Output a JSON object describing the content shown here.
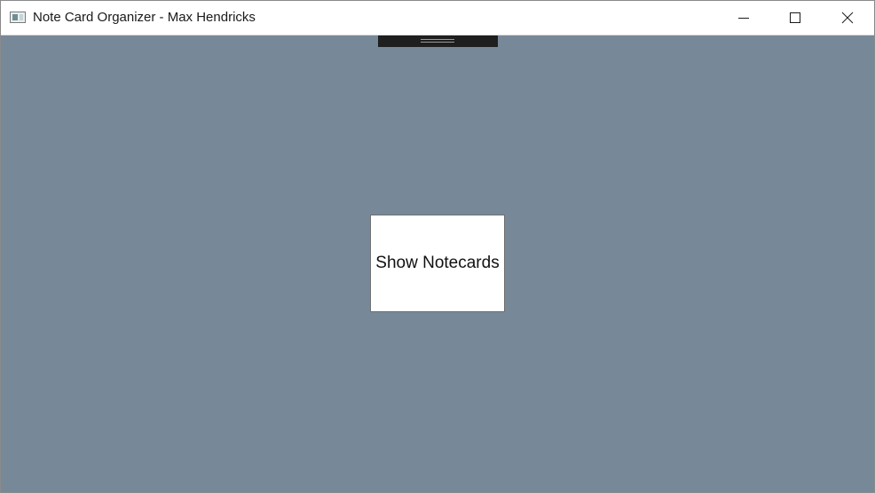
{
  "window": {
    "title": "Note Card Organizer - Max Hendricks",
    "icon": "app-window-icon",
    "controls": {
      "minimize_icon": "minimize-icon",
      "maximize_icon": "maximize-icon",
      "close_icon": "close-icon"
    }
  },
  "main": {
    "background_color": "#778899",
    "show_button_label": "Show Notecards"
  }
}
